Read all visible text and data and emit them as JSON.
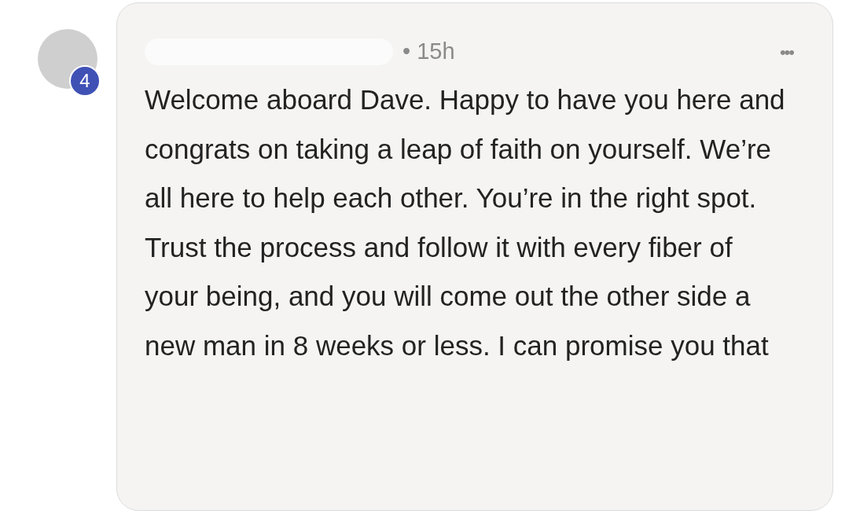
{
  "comment": {
    "avatar": {
      "badge": "4"
    },
    "time": "• 15h",
    "menu": "•••",
    "body": "Welcome aboard Dave. Happy to have you here and congrats on taking a leap of faith on yourself. We’re all here to help each other. You’re in the right spot. Trust the process and follow it with every fiber of your being, and you will come out the other side a new man in 8 weeks or less. I can promise you that"
  }
}
